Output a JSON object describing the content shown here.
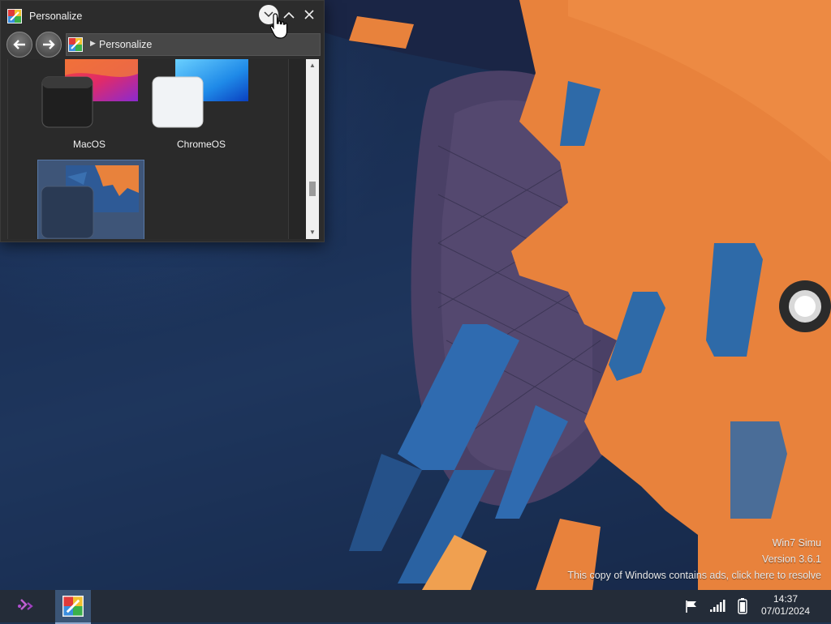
{
  "window": {
    "title": "Personalize",
    "address": "Personalize",
    "themes": [
      {
        "label": "MacOS"
      },
      {
        "label": "ChromeOS"
      },
      {
        "label": ""
      }
    ]
  },
  "watermark": {
    "line1": "Win7 Simu",
    "line2": "Version 3.6.1",
    "line3": "This copy of Windows contains ads, click here to resolve"
  },
  "taskbar": {
    "time": "14:37",
    "date": "07/01/2024"
  },
  "colors": {
    "accent_orange": "#e8823c",
    "accent_blue": "#2e6aa8",
    "taskbar": "#242c38",
    "selection": "#3e5578"
  },
  "icons": {
    "minimize": "chevron-down-icon",
    "maximize": "chevron-up-icon",
    "close": "close-icon",
    "back": "arrow-left-icon",
    "forward": "arrow-right-icon",
    "start": "start-icon",
    "flag": "flag-icon",
    "signal": "signal-icon",
    "battery": "battery-icon"
  }
}
